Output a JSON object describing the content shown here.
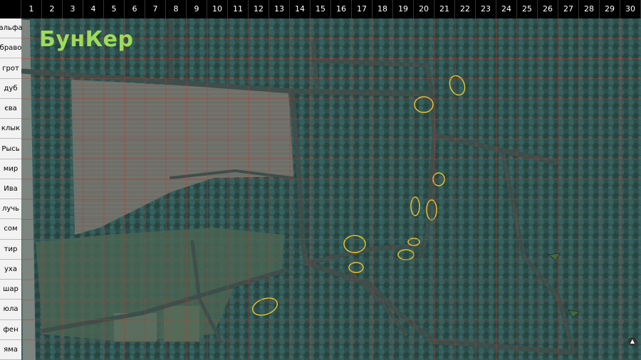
{
  "title": "БунКер",
  "columns": [
    "1",
    "2",
    "3",
    "4",
    "5",
    "6",
    "7",
    "8",
    "9",
    "10",
    "11",
    "12",
    "13",
    "14",
    "15",
    "16",
    "17",
    "18",
    "19",
    "20",
    "21",
    "22",
    "23",
    "24",
    "25",
    "26",
    "27",
    "28",
    "29",
    "30"
  ],
  "rows": [
    "альфа",
    "браво",
    "грот",
    "дуб",
    "єва",
    "клык",
    "Рысь",
    "мир",
    "Ива",
    "лучь",
    "сом",
    "тир",
    "уха",
    "шар",
    "юла",
    "фен",
    "яма"
  ],
  "colors": {
    "forest": "#2f5452",
    "field": "#6a6c66",
    "road": "#3f4f4c",
    "grid": "#c0392b",
    "marker": "#e6c22c",
    "title": "#9ddc5a"
  },
  "markers_legend": "yellow outlined trench/bunker marks",
  "icons": [
    "north-arrow-icon"
  ]
}
